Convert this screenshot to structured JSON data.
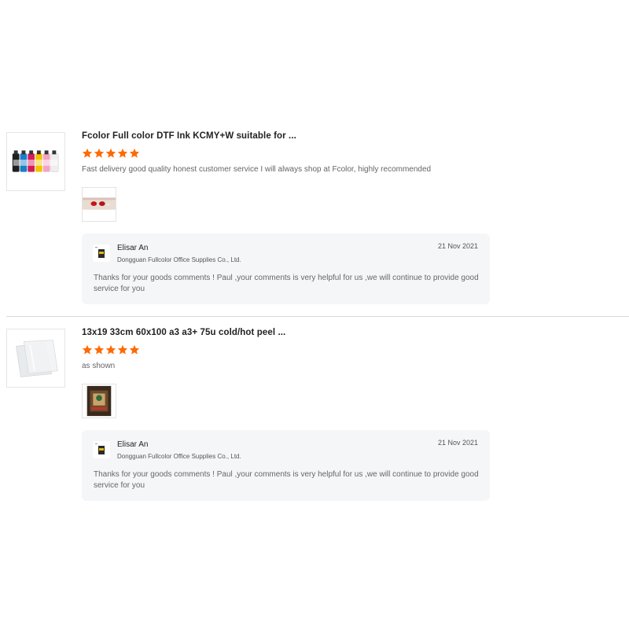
{
  "reviews": [
    {
      "product_title": "Fcolor Full color DTF Ink KCMY+W suitable for ...",
      "product_image": "ink-bottles-image",
      "rating": 5,
      "rating_max": 5,
      "comment": "Fast delivery good quality honest customer service I will always shop at Fcolor, highly recommended",
      "photo": "ink-sample-photo",
      "reply": {
        "name": "Elisar An",
        "company": "Dongguan Fullcolor Office Supplies Co., Ltd.",
        "date": "21 Nov 2021",
        "text": "Thanks for your goods comments ! Paul ,your comments is very helpful for us ,we will continue to provide good service for you"
      }
    },
    {
      "product_title": "13x19 33cm 60x100 a3 a3+ 75u cold/hot peel ...",
      "product_image": "transfer-film-image",
      "rating": 5,
      "rating_max": 5,
      "comment": "as shown",
      "photo": "printed-transfer-photo",
      "reply": {
        "name": "Elisar An",
        "company": "Dongguan Fullcolor Office Supplies Co., Ltd.",
        "date": "21 Nov 2021",
        "text": "Thanks for your goods comments ! Paul ,your comments is very helpful for us ,we will continue to provide good service for you"
      }
    }
  ],
  "colors": {
    "star": "#ff6a00",
    "reply_bg": "#f5f6f8",
    "divider": "#d9d9d9"
  }
}
